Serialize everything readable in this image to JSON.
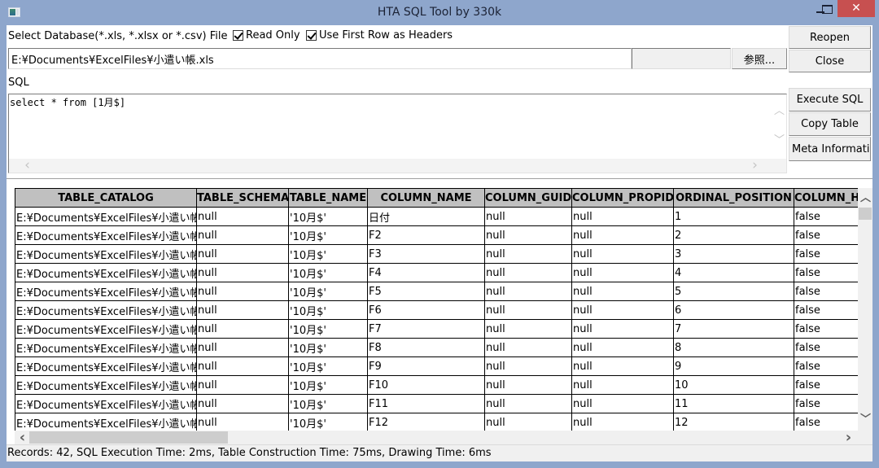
{
  "window": {
    "title": "HTA SQL Tool by 330k",
    "icon": "app-icon",
    "controls": {
      "minimize": "_",
      "maximize": "□",
      "close": "✕"
    },
    "close_color": "#c75050",
    "frame_color": "#8ea6cc"
  },
  "file": {
    "label": "Select Database(*.xls, *.xlsx or *.csv) File",
    "read_only_label": "Read Only",
    "read_only_checked": true,
    "first_row_label": "Use First Row as Headers",
    "first_row_checked": true,
    "path_value": "E:¥Documents¥ExcelFiles¥小遣い帳.xls",
    "browse_label": "参照...",
    "reopen_label": "Reopen",
    "close_label": "Close"
  },
  "sql": {
    "label": "SQL",
    "query": "select * from [1月$]",
    "execute_label": "Execute SQL",
    "copy_label": "Copy Table",
    "meta_label": "Meta Informatio"
  },
  "table": {
    "columns": [
      "TABLE_CATALOG",
      "TABLE_SCHEMA",
      "TABLE_NAME",
      "COLUMN_NAME",
      "COLUMN_GUID",
      "COLUMN_PROPID",
      "ORDINAL_POSITION",
      "COLUMN_H"
    ],
    "rows": [
      [
        "E:¥Documents¥ExcelFiles¥小遣い帳",
        "null",
        "'10月$'",
        "日付",
        "null",
        "null",
        "1",
        "false"
      ],
      [
        "E:¥Documents¥ExcelFiles¥小遣い帳",
        "null",
        "'10月$'",
        "F2",
        "null",
        "null",
        "2",
        "false"
      ],
      [
        "E:¥Documents¥ExcelFiles¥小遣い帳",
        "null",
        "'10月$'",
        "F3",
        "null",
        "null",
        "3",
        "false"
      ],
      [
        "E:¥Documents¥ExcelFiles¥小遣い帳",
        "null",
        "'10月$'",
        "F4",
        "null",
        "null",
        "4",
        "false"
      ],
      [
        "E:¥Documents¥ExcelFiles¥小遣い帳",
        "null",
        "'10月$'",
        "F5",
        "null",
        "null",
        "5",
        "false"
      ],
      [
        "E:¥Documents¥ExcelFiles¥小遣い帳",
        "null",
        "'10月$'",
        "F6",
        "null",
        "null",
        "6",
        "false"
      ],
      [
        "E:¥Documents¥ExcelFiles¥小遣い帳",
        "null",
        "'10月$'",
        "F7",
        "null",
        "null",
        "7",
        "false"
      ],
      [
        "E:¥Documents¥ExcelFiles¥小遣い帳",
        "null",
        "'10月$'",
        "F8",
        "null",
        "null",
        "8",
        "false"
      ],
      [
        "E:¥Documents¥ExcelFiles¥小遣い帳",
        "null",
        "'10月$'",
        "F9",
        "null",
        "null",
        "9",
        "false"
      ],
      [
        "E:¥Documents¥ExcelFiles¥小遣い帳",
        "null",
        "'10月$'",
        "F10",
        "null",
        "null",
        "10",
        "false"
      ],
      [
        "E:¥Documents¥ExcelFiles¥小遣い帳",
        "null",
        "'10月$'",
        "F11",
        "null",
        "null",
        "11",
        "false"
      ],
      [
        "E:¥Documents¥ExcelFiles¥小遣い帳",
        "null",
        "'10月$'",
        "F12",
        "null",
        "null",
        "12",
        "false"
      ]
    ]
  },
  "scroll": {
    "up": "︿",
    "down": "﹀",
    "left": "‹",
    "right": "›"
  },
  "status": {
    "text": "Records: 42, SQL Execution Time: 2ms, Table Construction Time: 75ms, Drawing Time: 6ms"
  }
}
